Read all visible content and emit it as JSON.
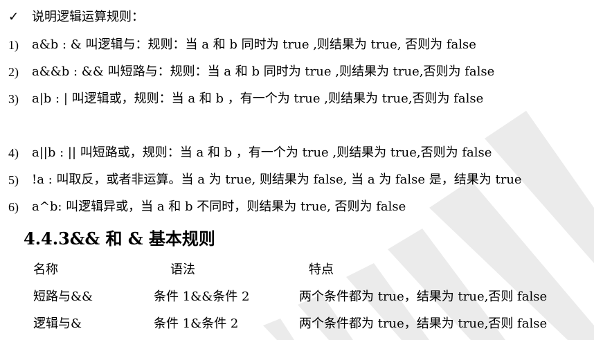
{
  "intro": {
    "bullet": "✓",
    "text": "说明逻辑运算规则："
  },
  "rules": [
    {
      "num": "1)",
      "text": "a&b : &  叫逻辑与：规则：当 a  和  b  同时为 true ,则结果为 true,  否则为 false"
    },
    {
      "num": "2)",
      "text": "a&&b : &&  叫短路与：规则：当 a  和  b  同时为 true ,则结果为 true,否则为 false"
    },
    {
      "num": "3)",
      "text": "a|b : |  叫逻辑或，规则：当 a  和  b  ，有一个为 true ,则结果为 true,否则为 false"
    },
    {
      "num": "4)",
      "text": "a||b : ||  叫短路或，规则：当 a  和  b  ，有一个为 true ,则结果为 true,否则为 false"
    },
    {
      "num": "5)",
      "text": "!a : 叫取反，或者非运算。当 a  为 true, 则结果为 false,  当  a  为 false 是，结果为 true"
    },
    {
      "num": "6)",
      "text": "a^b:  叫逻辑异或，当  a  和  b  不同时，则结果为 true,  否则为 false"
    }
  ],
  "section_heading": "4.4.3&&  和  &  基本规则",
  "table": {
    "headers": [
      "名称",
      "语法",
      "特点"
    ],
    "rows": [
      [
        "短路与&&",
        "条件 1&&条件 2",
        "两个条件都为 true，结果为 true,否则 false"
      ],
      [
        "逻辑与&",
        "条件 1&条件 2",
        "两个条件都为 true，结果为 true,否则 false"
      ]
    ]
  },
  "watermark_color": "#e9e9e9"
}
